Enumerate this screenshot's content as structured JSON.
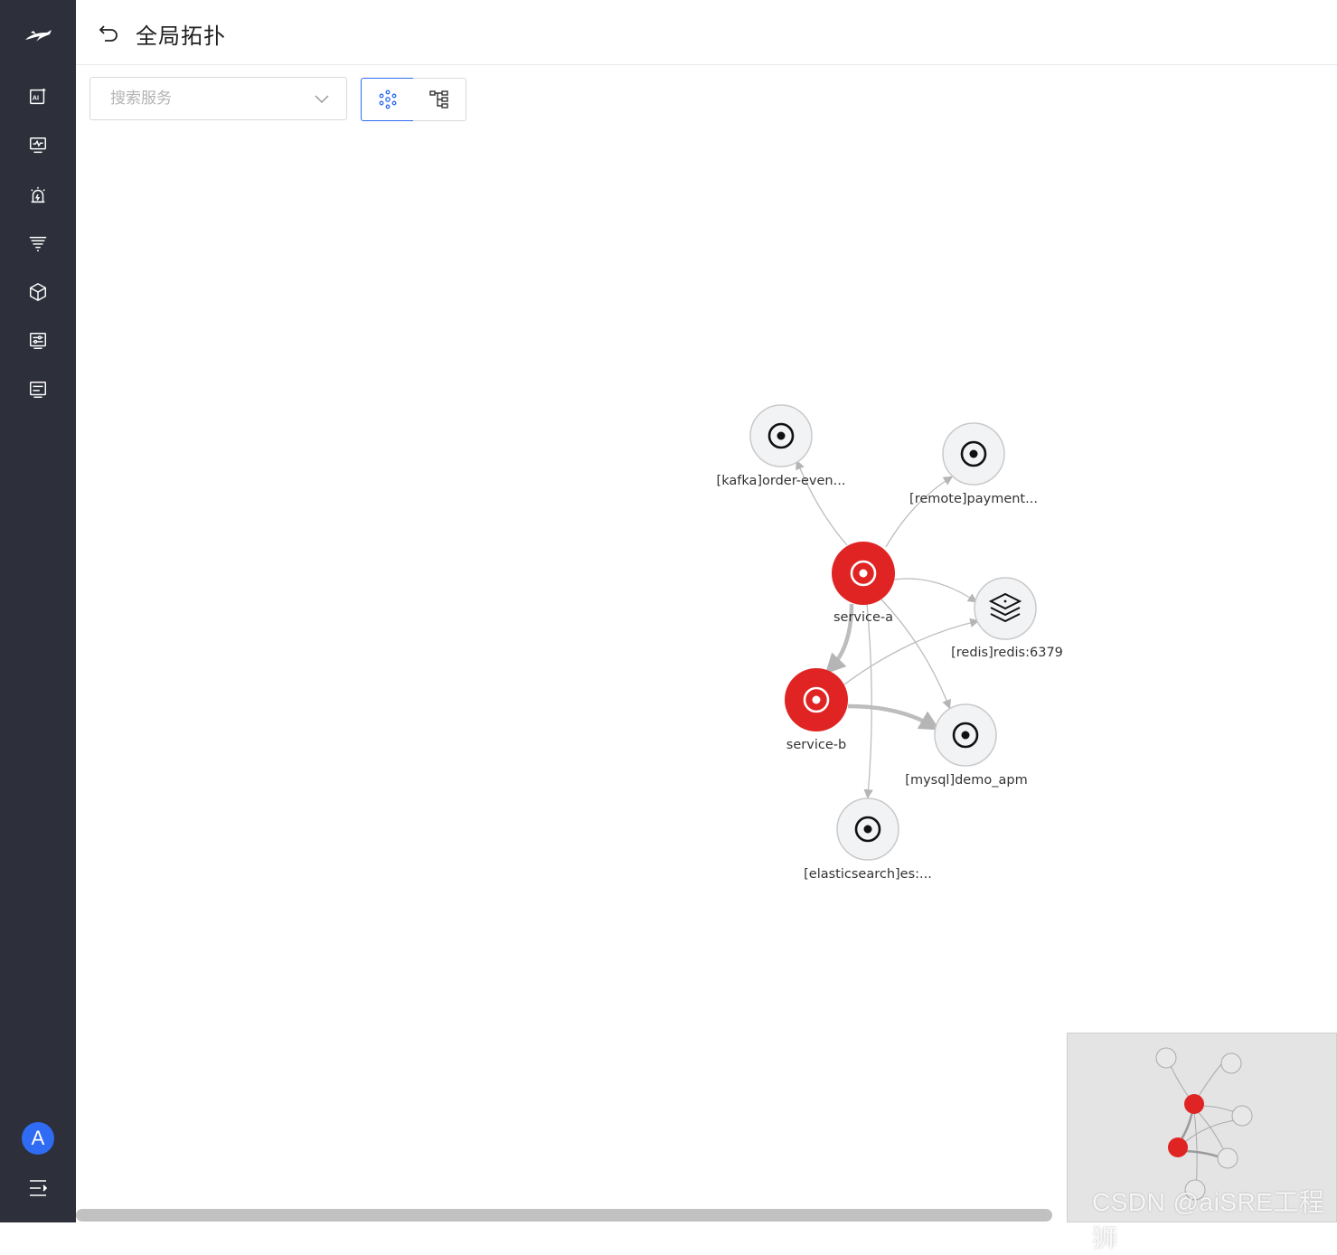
{
  "header": {
    "title": "全局拓扑"
  },
  "toolbar": {
    "search_placeholder": "搜索服务"
  },
  "sidebar": {
    "items": [
      {
        "icon": "ai-icon"
      },
      {
        "icon": "monitor-icon"
      },
      {
        "icon": "alarm-icon"
      },
      {
        "icon": "filter-list-icon"
      },
      {
        "icon": "cube-icon"
      },
      {
        "icon": "settings-panel-icon"
      },
      {
        "icon": "console-panel-icon"
      }
    ],
    "avatar": "A"
  },
  "topology": {
    "nodes": [
      {
        "id": "kafka",
        "label": "[kafka]order-even...",
        "status": "normal",
        "icon": "target-icon"
      },
      {
        "id": "remote",
        "label": "[remote]payment...",
        "status": "normal",
        "icon": "target-icon"
      },
      {
        "id": "service-a",
        "label": "service-a",
        "status": "error",
        "icon": "target-icon"
      },
      {
        "id": "redis",
        "label": "[redis]redis:6379",
        "status": "normal",
        "icon": "layers-icon"
      },
      {
        "id": "service-b",
        "label": "service-b",
        "status": "error",
        "icon": "target-icon"
      },
      {
        "id": "mysql",
        "label": "[mysql]demo_apm",
        "status": "normal",
        "icon": "target-icon"
      },
      {
        "id": "elasticsearch",
        "label": "[elasticsearch]es:...",
        "status": "normal",
        "icon": "target-icon"
      }
    ],
    "edges": [
      {
        "from": "service-a",
        "to": "kafka",
        "weight": "thin"
      },
      {
        "from": "service-a",
        "to": "remote",
        "weight": "thin"
      },
      {
        "from": "service-a",
        "to": "redis",
        "weight": "thin"
      },
      {
        "from": "service-a",
        "to": "mysql",
        "weight": "thin"
      },
      {
        "from": "service-a",
        "to": "elasticsearch",
        "weight": "thin"
      },
      {
        "from": "service-a",
        "to": "service-b",
        "weight": "thick"
      },
      {
        "from": "service-b",
        "to": "redis",
        "weight": "thin"
      },
      {
        "from": "service-b",
        "to": "mysql",
        "weight": "thick"
      }
    ]
  },
  "colors": {
    "error": "#e02424",
    "normal_fill": "#f2f3f5",
    "normal_stroke": "#c9c9c9",
    "accent": "#2f6bf3",
    "sidebar": "#2d2f3a"
  },
  "watermark": "CSDN @aiSRE工程狮"
}
